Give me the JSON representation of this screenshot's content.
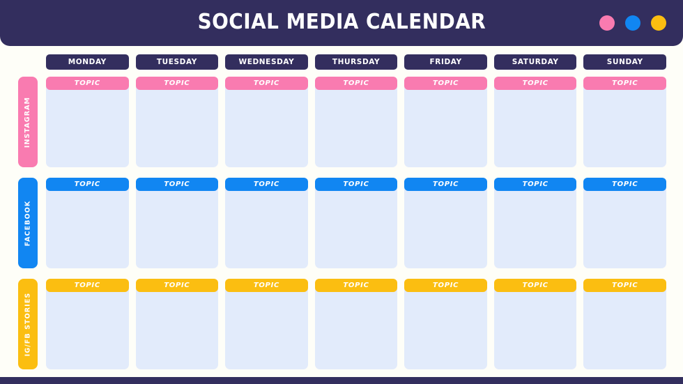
{
  "header": {
    "title": "SOCIAL MEDIA CALENDAR",
    "background_color": "#332E5E",
    "title_color": "#FFFFFF",
    "dots": [
      {
        "name": "pink-dot",
        "color": "#F97BB0"
      },
      {
        "name": "blue-dot",
        "color": "#1186F2"
      },
      {
        "name": "yellow-dot",
        "color": "#FBBE11"
      }
    ]
  },
  "calendar": {
    "day_headers": [
      "MONDAY",
      "TUESDAY",
      "WEDNESDAY",
      "THURSDAY",
      "FRIDAY",
      "SATURDAY",
      "SUNDAY"
    ],
    "day_header_color": "#332E5E",
    "cell_body_color": "#E2EBFB",
    "rows": [
      {
        "label": "INSTAGRAM",
        "accent_color": "#F97BB0",
        "cells": [
          {
            "topic": "TOPIC"
          },
          {
            "topic": "TOPIC"
          },
          {
            "topic": "TOPIC"
          },
          {
            "topic": "TOPIC"
          },
          {
            "topic": "TOPIC"
          },
          {
            "topic": "TOPIC"
          },
          {
            "topic": "TOPIC"
          }
        ]
      },
      {
        "label": "FACEBOOK",
        "accent_color": "#1186F2",
        "cells": [
          {
            "topic": "TOPIC"
          },
          {
            "topic": "TOPIC"
          },
          {
            "topic": "TOPIC"
          },
          {
            "topic": "TOPIC"
          },
          {
            "topic": "TOPIC"
          },
          {
            "topic": "TOPIC"
          },
          {
            "topic": "TOPIC"
          }
        ]
      },
      {
        "label": "IG/FB STORIES",
        "accent_color": "#FBBE11",
        "cells": [
          {
            "topic": "TOPIC"
          },
          {
            "topic": "TOPIC"
          },
          {
            "topic": "TOPIC"
          },
          {
            "topic": "TOPIC"
          },
          {
            "topic": "TOPIC"
          },
          {
            "topic": "TOPIC"
          },
          {
            "topic": "TOPIC"
          }
        ]
      }
    ]
  },
  "footer": {
    "background_color": "#332E5E"
  },
  "page": {
    "background_color": "#FEFEF8"
  }
}
